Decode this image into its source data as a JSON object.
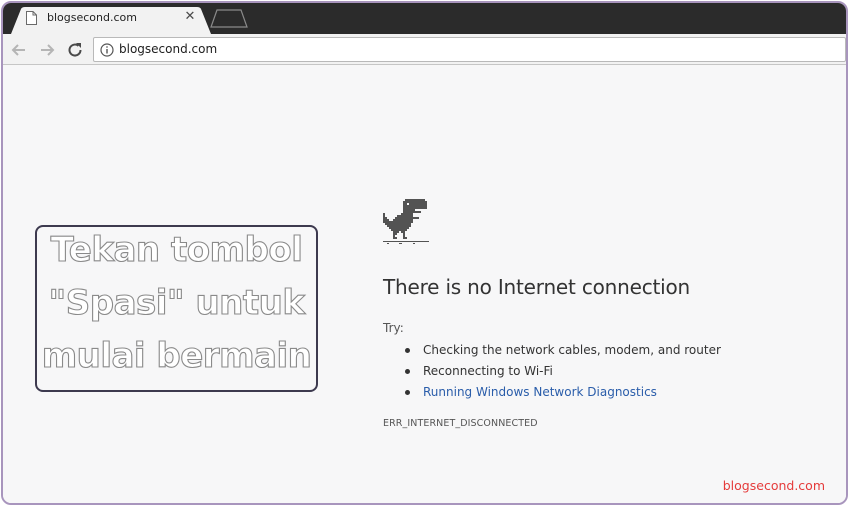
{
  "browser": {
    "tab": {
      "title": "blogsecond.com",
      "close_glyph": "✕",
      "icon": "page-icon"
    },
    "toolbar": {
      "back_icon": "arrow-left-icon",
      "forward_icon": "arrow-right-icon",
      "reload_icon": "reload-icon"
    },
    "omnibox": {
      "security_icon": "info-icon",
      "url": "blogsecond.com"
    }
  },
  "error_page": {
    "icon": "dino-icon",
    "heading": "There is no Internet connection",
    "try_label": "Try:",
    "suggestions": [
      "Checking the network cables, modem, and router",
      "Reconnecting to Wi-Fi",
      "Running Windows Network Diagnostics"
    ],
    "error_code": "ERR_INTERNET_DISCONNECTED"
  },
  "overlay": {
    "lines": [
      "Tekan tombol",
      "\"Spasi\" untuk",
      "mulai bermain"
    ]
  },
  "watermark": "blogsecond.com",
  "colors": {
    "frame_border": "#a895bd",
    "tabstrip_bg": "#2b2b2b",
    "toolbar_bg": "#f2f2f2",
    "page_bg": "#f7f7f8",
    "link": "#2a5daa",
    "watermark": "#e53b3b"
  }
}
